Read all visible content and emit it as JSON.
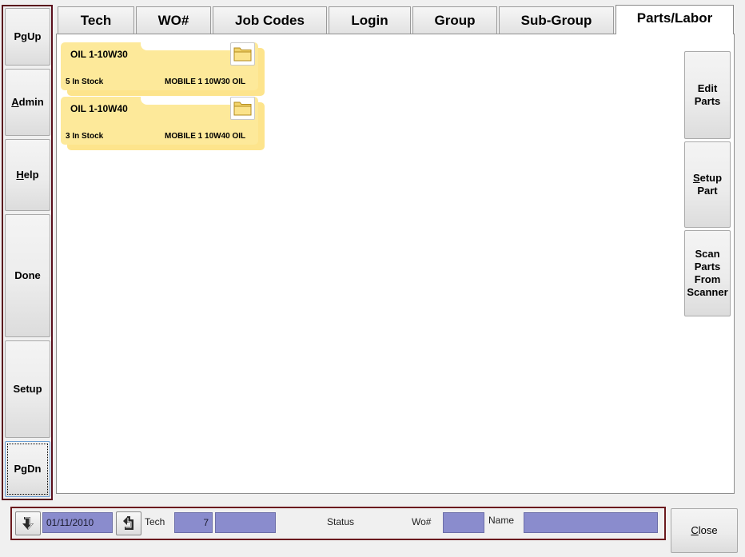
{
  "left_nav": {
    "pgup": "PgUp",
    "admin_prefix": "",
    "admin_ul": "A",
    "admin_rest": "dmin",
    "help_prefix": "",
    "help_ul": "H",
    "help_rest": "elp",
    "done": "Done",
    "setup": "Setup",
    "pgdn": "PgDn"
  },
  "tabs": [
    "Tech",
    "WO#",
    "Job Codes",
    "Login",
    "Group",
    "Sub-Group",
    "Parts/Labor"
  ],
  "active_tab": "Parts/Labor",
  "parts": [
    {
      "name": "OIL 1-10W30",
      "stock": "5 In Stock",
      "description": "MOBILE 1 10W30 OIL"
    },
    {
      "name": "OIL 1-10W40",
      "stock": "3 In Stock",
      "description": "MOBILE 1 10W40 OIL"
    }
  ],
  "side_buttons": {
    "edit_parts": [
      "Edit",
      "Parts"
    ],
    "setup_part_ul": "S",
    "setup_part_rest": "etup",
    "setup_part_line2": "Part",
    "scan_parts": [
      "Scan",
      "Parts",
      "From",
      "Scanner"
    ]
  },
  "status_bar": {
    "date": "01/11/2010",
    "tech_label": "Tech",
    "tech_value": "7",
    "tech_name": "",
    "status_label": "Status",
    "wo_label": "Wo#",
    "wo_value": "",
    "name_label": "Name",
    "name_value": ""
  },
  "close": {
    "ul": "C",
    "rest": "lose"
  },
  "colors": {
    "card": "#fde99a",
    "field": "#8a8ccd",
    "frame": "#5a0f1c"
  },
  "icons": [
    "folder-icon",
    "arrow-back-icon",
    "arrow-refresh-icon"
  ]
}
